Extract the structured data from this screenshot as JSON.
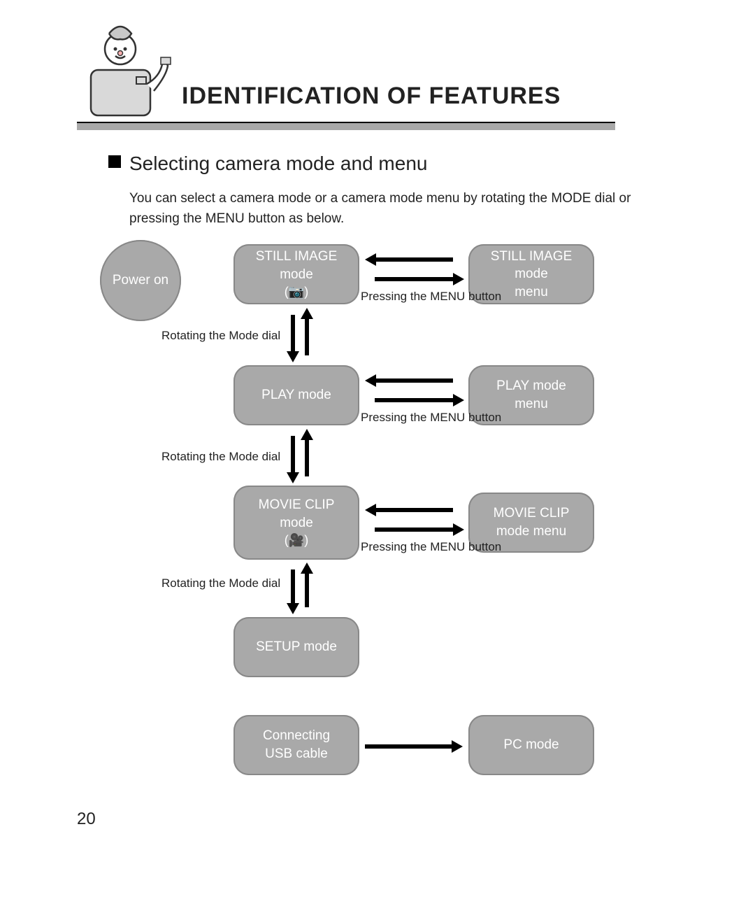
{
  "header": {
    "title": "IDENTIFICATION OF FEATURES",
    "subheading": "Selecting camera mode and menu",
    "paragraph": "You can select a camera mode or a camera mode menu by rotating the MODE dial or pressing the MENU button as below."
  },
  "diagram": {
    "power_on": "Power on",
    "still_image_mode": "STILL IMAGE mode",
    "still_image_icon": "(📷)",
    "still_image_menu_l1": "STILL IMAGE mode",
    "still_image_menu_l2": "menu",
    "play_mode": "PLAY mode",
    "play_menu_l1": "PLAY mode",
    "play_menu_l2": "menu",
    "movie_clip_l1": "MOVIE CLIP",
    "movie_clip_l2": "mode",
    "movie_clip_icon": "(🎥)",
    "movie_menu_l1": "MOVIE CLIP",
    "movie_menu_l2": "mode menu",
    "setup_mode": "SETUP mode",
    "connecting_l1": "Connecting",
    "connecting_l2": "USB cable",
    "pc_mode": "PC mode",
    "cap_rotate": "Rotating the Mode dial",
    "cap_menu": "Pressing the MENU button"
  },
  "page_number": "20"
}
